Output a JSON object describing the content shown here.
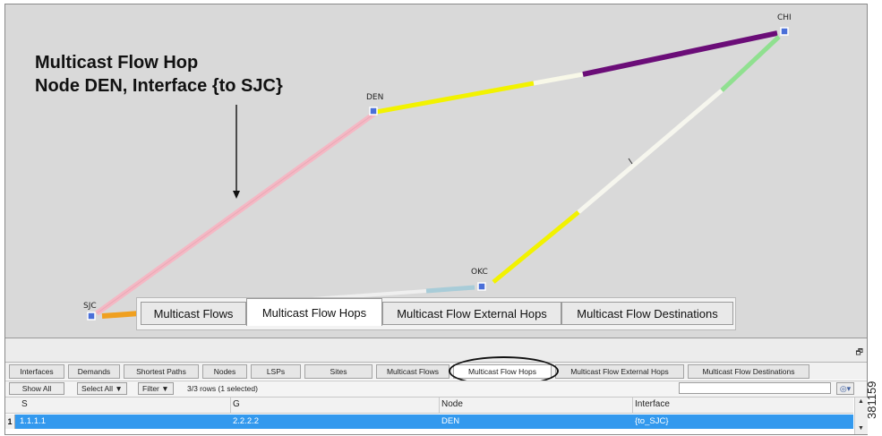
{
  "callout": {
    "line1": "Multicast Flow Hop",
    "line2": "Node DEN, Interface {to SJC}"
  },
  "nodes": {
    "sjc": "SJC",
    "den": "DEN",
    "chi": "CHI",
    "okc": "OKC"
  },
  "zoom_tabs": [
    {
      "label": "Multicast Flows",
      "active": false
    },
    {
      "label": "Multicast Flow Hops",
      "active": true
    },
    {
      "label": "Multicast Flow External Hops",
      "active": false
    },
    {
      "label": "Multicast Flow Destinations",
      "active": false
    }
  ],
  "tabs": [
    {
      "label": "Interfaces"
    },
    {
      "label": "Demands"
    },
    {
      "label": "Shortest Paths"
    },
    {
      "label": "Nodes"
    },
    {
      "label": "LSPs"
    },
    {
      "label": "Sites"
    },
    {
      "label": "Multicast Flows"
    },
    {
      "label": "Multicast Flow Hops",
      "active": true
    },
    {
      "label": "Multicast Flow External Hops"
    },
    {
      "label": "Multicast Flow Destinations"
    }
  ],
  "toolbar": {
    "show_all": "Show All",
    "select_all": "Select All",
    "filter": "Filter",
    "dropdown_arrow": "▼",
    "row_count": "3/3 rows (1 selected)"
  },
  "table": {
    "columns": [
      "S",
      "G",
      "Node",
      "Interface"
    ],
    "rows": [
      {
        "num": "1",
        "s": "1.1.1.1",
        "g": "2.2.2.2",
        "node": "DEN",
        "interface": "{to_SJC}"
      }
    ]
  },
  "figure_id": "381159",
  "colors": {
    "map_bg": "#d9d9d9",
    "node": "#4a6fd8",
    "pink": "#f4b8c4",
    "yellow": "#f2f200",
    "purple": "#6b0d78",
    "green": "#90e090",
    "orange": "#f0a020",
    "lightblue": "#a8ccd8",
    "selection": "#3399ee"
  }
}
